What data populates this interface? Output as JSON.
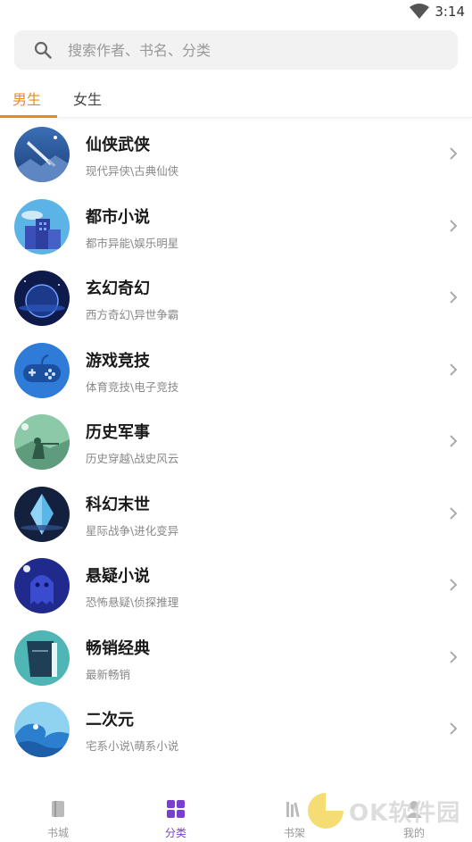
{
  "status": {
    "time": "3:14"
  },
  "search": {
    "placeholder": "搜索作者、书名、分类"
  },
  "tabs": [
    {
      "label": "男生",
      "active": true
    },
    {
      "label": "女生",
      "active": false
    }
  ],
  "categories": [
    {
      "title": "仙侠武侠",
      "subtitle": "现代异侠\\古典仙侠",
      "icon": "sword-icon"
    },
    {
      "title": "都市小说",
      "subtitle": "都市异能\\娱乐明星",
      "icon": "city-icon"
    },
    {
      "title": "玄幻奇幻",
      "subtitle": "西方奇幻\\异世争霸",
      "icon": "planet-icon"
    },
    {
      "title": "游戏竞技",
      "subtitle": "体育竞技\\电子竞技",
      "icon": "gamepad-icon"
    },
    {
      "title": "历史军事",
      "subtitle": "历史穿越\\战史风云",
      "icon": "soldier-icon"
    },
    {
      "title": "科幻末世",
      "subtitle": "星际战争\\进化变异",
      "icon": "crystal-icon"
    },
    {
      "title": "悬疑小说",
      "subtitle": "恐怖悬疑\\侦探推理",
      "icon": "ghost-icon"
    },
    {
      "title": "畅销经典",
      "subtitle": "最新畅销",
      "icon": "book-icon"
    },
    {
      "title": "二次元",
      "subtitle": "宅系小说\\萌系小说",
      "icon": "wave-icon"
    }
  ],
  "bottom_nav": [
    {
      "label": "书城",
      "icon": "bookstore-icon",
      "active": false
    },
    {
      "label": "分类",
      "icon": "category-grid-icon",
      "active": true
    },
    {
      "label": "书架",
      "icon": "bookshelf-icon",
      "active": false
    },
    {
      "label": "我的",
      "icon": "profile-icon",
      "active": false
    }
  ],
  "watermark": {
    "text": "OK软件园"
  },
  "colors": {
    "accent": "#e88a1e",
    "nav_active": "#7a3fd1"
  }
}
